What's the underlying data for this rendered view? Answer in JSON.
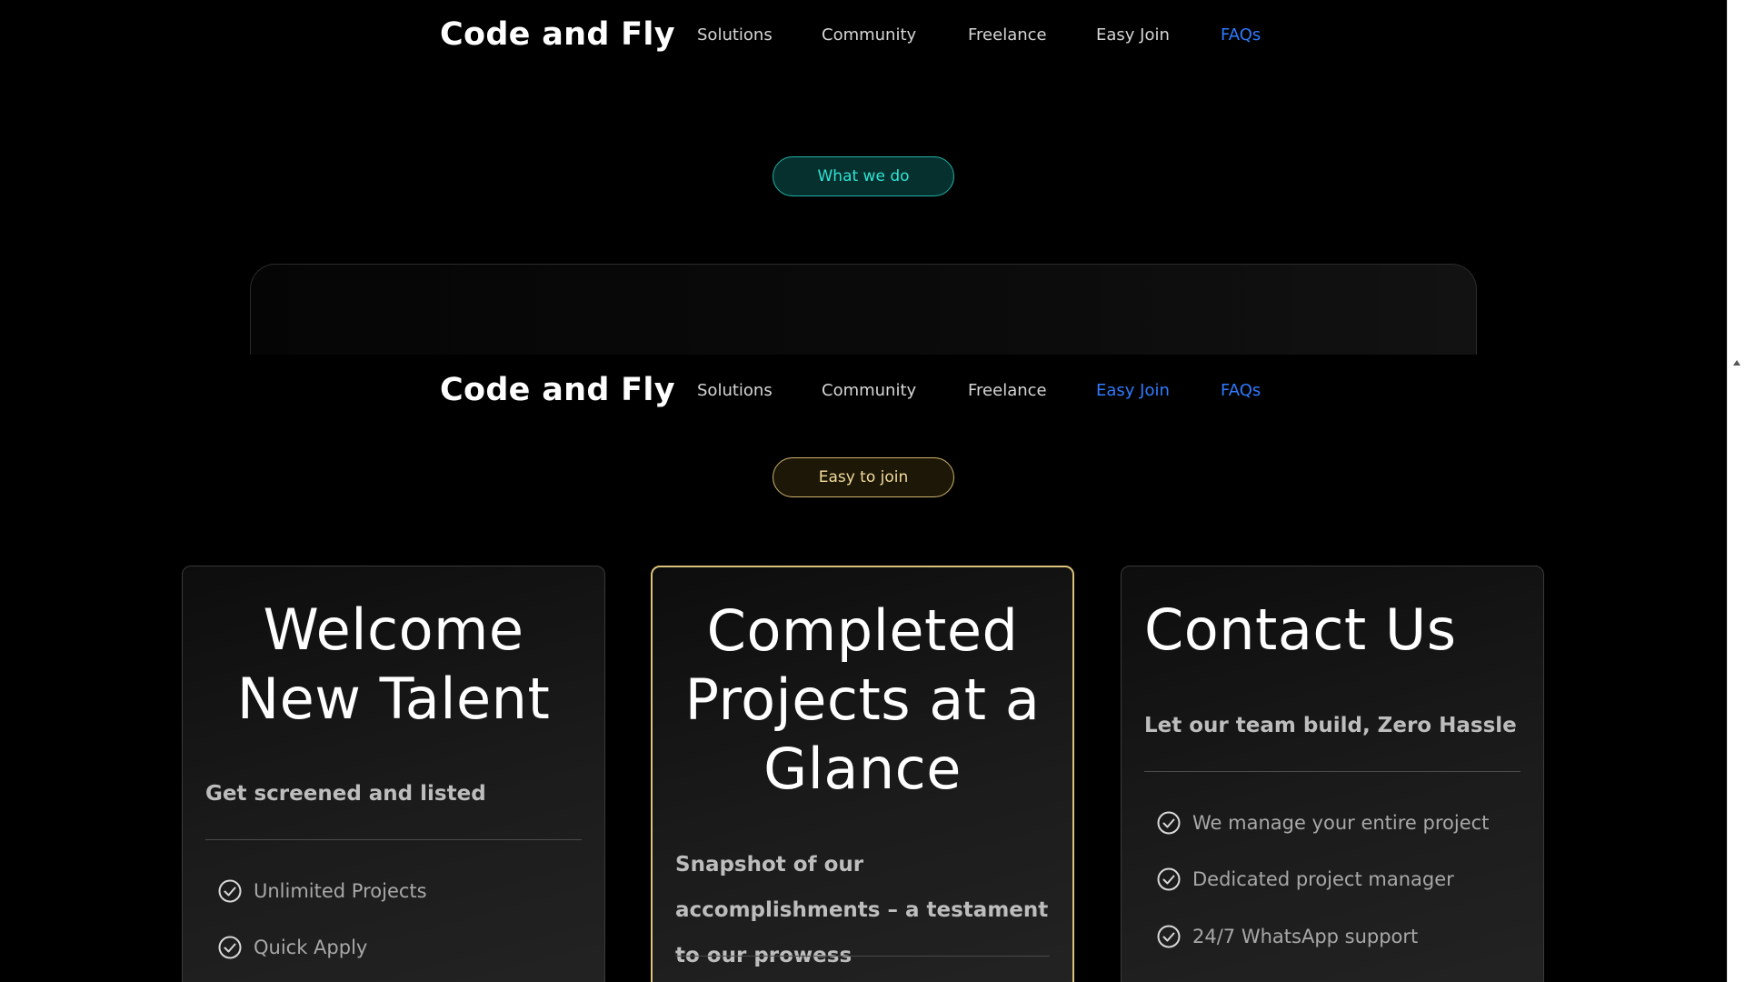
{
  "nav": {
    "brand": "Code and Fly",
    "links": [
      "Solutions",
      "Community",
      "Freelance",
      "Easy Join",
      "FAQs"
    ]
  },
  "top_section": {
    "pill": "What we do"
  },
  "easy_section": {
    "pill": "Easy to join"
  },
  "cards": [
    {
      "title": "Welcome New Talent",
      "subtitle": "Get screened and listed",
      "features": [
        "Unlimited Projects",
        "Quick Apply"
      ]
    },
    {
      "title": "Completed Projects at a Glance",
      "subtitle": "Snapshot of our accomplishments – a testament to our prowess",
      "features": []
    },
    {
      "title": "Contact Us",
      "subtitle": "Let our team build, Zero Hassle",
      "features": [
        "We manage your entire project",
        "Dedicated project manager",
        "24/7 WhatsApp support"
      ]
    }
  ],
  "colors": {
    "active_link": "#2f7bff",
    "teal_accent": "#2fe3d3",
    "gold_accent": "#d9c27a"
  }
}
